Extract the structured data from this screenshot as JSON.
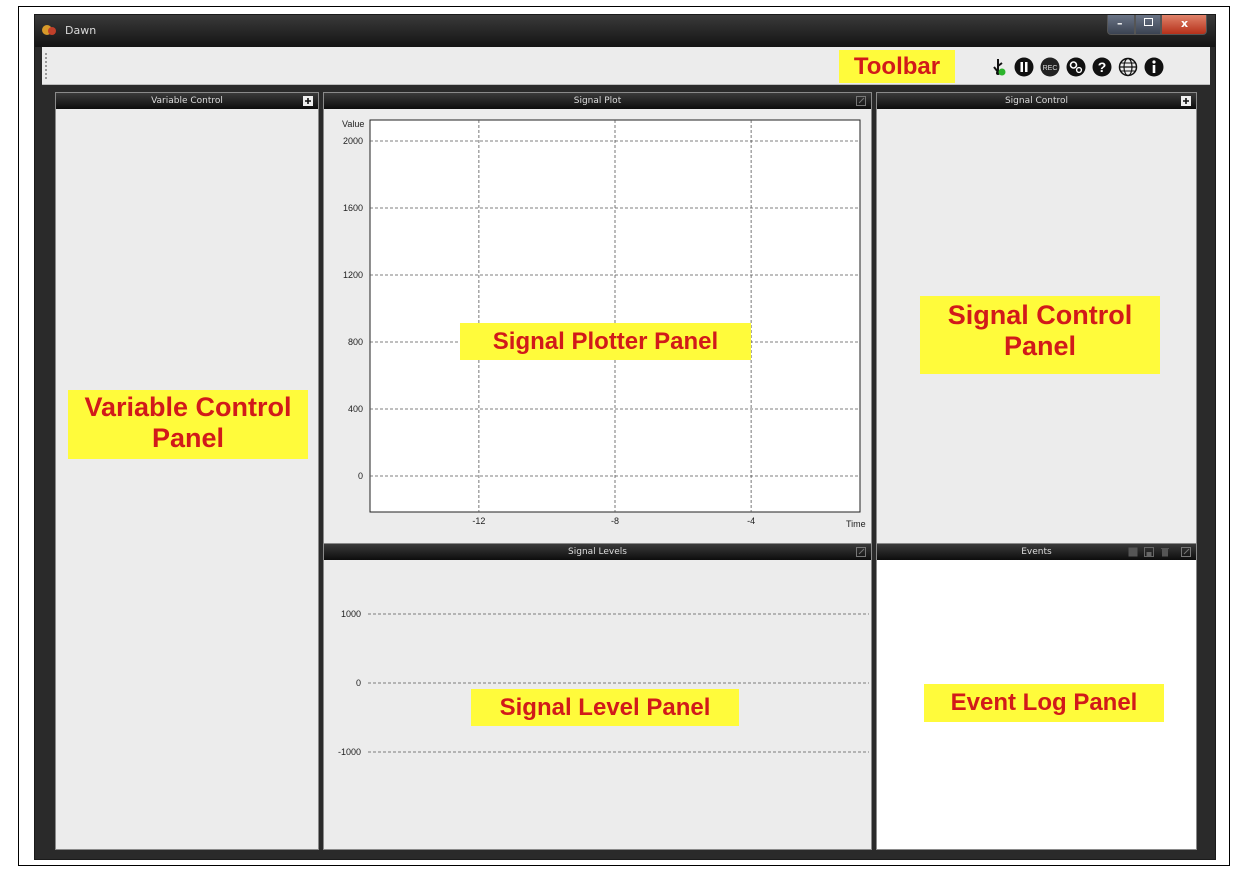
{
  "window": {
    "title": "Dawn"
  },
  "toolbar": {
    "label": "Toolbar",
    "icons": [
      "usb-connect-icon",
      "pause-icon",
      "record-icon",
      "settings-icon",
      "help-icon",
      "web-icon",
      "info-icon"
    ],
    "record_text": "REC"
  },
  "panels": {
    "variable_control": {
      "title": "Variable Control",
      "annotation_line1": "Variable Control",
      "annotation_line2": "Panel"
    },
    "signal_plot": {
      "title": "Signal Plot",
      "annotation": "Signal Plotter Panel"
    },
    "signal_control": {
      "title": "Signal Control",
      "annotation_line1": "Signal Control",
      "annotation_line2": "Panel"
    },
    "signal_levels": {
      "title": "Signal Levels",
      "annotation": "Signal Level Panel"
    },
    "events": {
      "title": "Events",
      "annotation": "Event Log Panel"
    }
  },
  "chart_data": [
    {
      "type": "line",
      "ylabel": "Value",
      "xlabel": "Time",
      "y_ticks": [
        0,
        400,
        800,
        1200,
        1600,
        2000
      ],
      "x_ticks": [
        -12,
        -8,
        -4
      ],
      "series": [],
      "grid": true
    },
    {
      "type": "bar",
      "y_ticks": [
        1000,
        0,
        -1000
      ],
      "series": [],
      "grid": true
    }
  ],
  "colors": {
    "annotation_bg": "#fffb3b",
    "annotation_text": "#d11a1a",
    "header_bg": "#1a1a1a"
  }
}
